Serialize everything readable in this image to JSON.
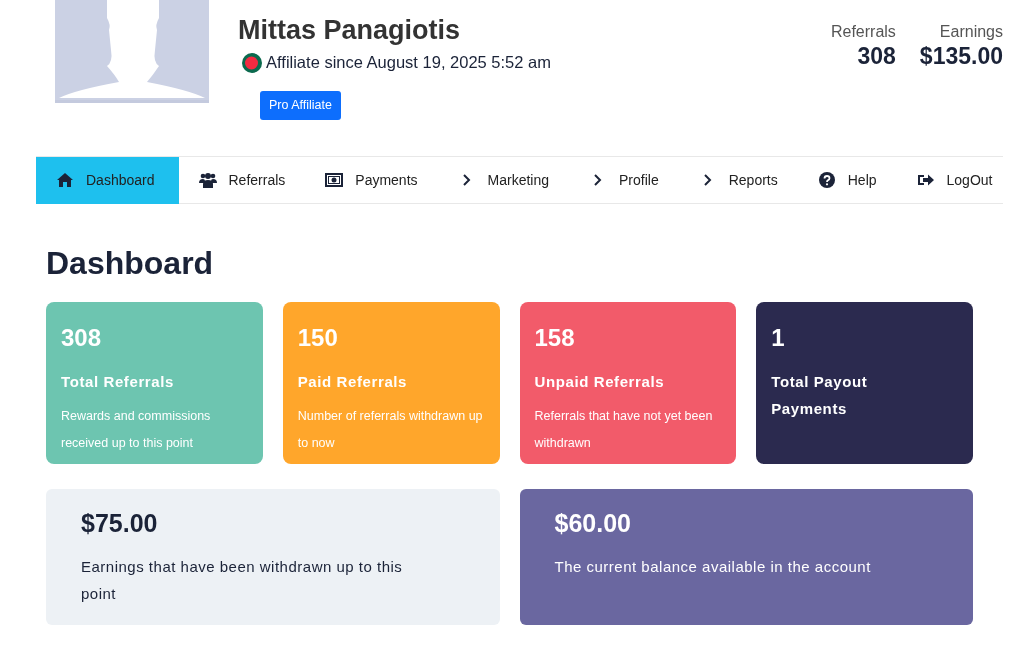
{
  "profile": {
    "name": "Mittas Panagiotis",
    "since": "Affiliate since August 19, 2025 5:52 am",
    "badge": "Pro Affiliate"
  },
  "summary": [
    {
      "label": "Referrals",
      "value": "308"
    },
    {
      "label": "Earnings",
      "value": "$135.00"
    }
  ],
  "nav": [
    {
      "label": "Dashboard",
      "selected": true
    },
    {
      "label": "Referrals",
      "selected": false
    },
    {
      "label": "Payments",
      "selected": false
    },
    {
      "label": "Marketing",
      "selected": false
    },
    {
      "label": "Profile",
      "selected": false
    },
    {
      "label": "Reports",
      "selected": false
    },
    {
      "label": "Help",
      "selected": false
    },
    {
      "label": "LogOut",
      "selected": false
    }
  ],
  "heading": "Dashboard",
  "stat_cards": [
    {
      "value": "308",
      "title": "Total Referrals",
      "description": "Rewards and commissions received up to this point",
      "color": "#6dc5b0"
    },
    {
      "value": "150",
      "title": "Paid Referrals",
      "description": "Number of referrals withdrawn up to now",
      "color": "#ffa62b"
    },
    {
      "value": "158",
      "title": "Unpaid Referrals",
      "description": "Referrals that have not yet been withdrawn",
      "color": "#f25b6a"
    },
    {
      "value": "1",
      "title": "Total Payout Payments",
      "color": "#2b2a4f"
    }
  ],
  "balance_cards": [
    {
      "value": "$75.00",
      "title": "Earnings that have been withdrawn up to this point",
      "color": "#edf1f5"
    },
    {
      "value": "$60.00",
      "title": "The current balance available in the account",
      "color": "#6a67a0"
    }
  ]
}
